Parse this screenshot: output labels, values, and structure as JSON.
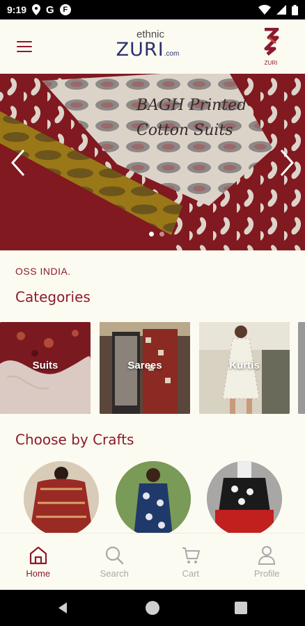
{
  "status_bar": {
    "time": "9:19",
    "g_icon": "G",
    "f_icon": "F",
    "icons": [
      "location-icon",
      "g-app-icon",
      "f-app-icon",
      "wifi-icon",
      "cellular-icon",
      "battery-icon"
    ]
  },
  "header": {
    "logo_small": "ethnic",
    "logo_main": "ZURI",
    "logo_suffix": ".com",
    "brand_mark_text": "ZURI"
  },
  "banner": {
    "line1": "BAGH Printed",
    "line2": "Cotton Suits",
    "slides": 2,
    "active_slide": 1
  },
  "marquee_text": "OSS INDIA.",
  "categories": {
    "title": "Categories",
    "items": [
      {
        "label": "Suits"
      },
      {
        "label": "Sarees"
      },
      {
        "label": "Kurtis"
      },
      {
        "label": ""
      }
    ]
  },
  "crafts": {
    "title": "Choose by Crafts"
  },
  "bottom_nav": {
    "items": [
      {
        "label": "Home",
        "icon": "home-icon",
        "active": true
      },
      {
        "label": "Search",
        "icon": "search-icon",
        "active": false
      },
      {
        "label": "Cart",
        "icon": "cart-icon",
        "active": false
      },
      {
        "label": "Profile",
        "icon": "profile-icon",
        "active": false
      }
    ]
  },
  "colors": {
    "accent": "#8b1a2e",
    "background": "#fcfbf2",
    "logo": "#2a2f6b",
    "inactive": "#a8a8a8"
  }
}
